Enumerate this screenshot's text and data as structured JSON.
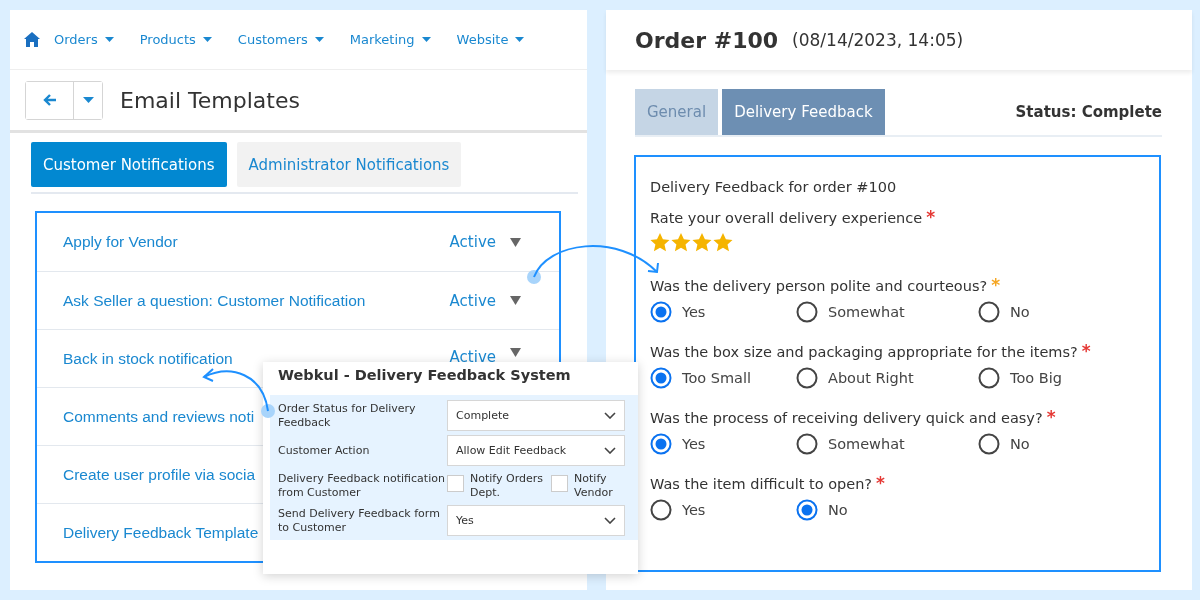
{
  "nav": {
    "items": [
      "Orders",
      "Products",
      "Customers",
      "Marketing",
      "Website"
    ]
  },
  "page": {
    "title": "Email Templates"
  },
  "template_tabs": [
    {
      "label": "Customer Notifications",
      "selected": true
    },
    {
      "label": "Administrator Notifications",
      "selected": false
    }
  ],
  "templates": [
    {
      "name": "Apply for Vendor",
      "status": "Active"
    },
    {
      "name": "Ask Seller a question: Customer Notification",
      "status": "Active"
    },
    {
      "name": "Back in stock notification",
      "status": "Active"
    },
    {
      "name": "Comments and reviews noti"
    },
    {
      "name": "Create user profile via socia"
    },
    {
      "name": "Delivery Feedback Template"
    }
  ],
  "popup": {
    "title": "Webkul - Delivery Feedback System",
    "fields": [
      {
        "kind": "select",
        "label": "Order Status for Delivery Feedback",
        "value": "Complete"
      },
      {
        "kind": "select",
        "label": "Customer Action",
        "value": "Allow Edit Feedback"
      },
      {
        "kind": "checkboxes",
        "label": "Delivery Feedback notification from Customer",
        "options": [
          {
            "label": "Notify Orders Dept.",
            "checked": false
          },
          {
            "label": "Notify Vendor",
            "checked": false
          }
        ]
      },
      {
        "kind": "select",
        "label": "Send Delivery Feedback form to Customer",
        "value": "Yes"
      }
    ]
  },
  "order": {
    "title": "Order #100",
    "date": "(08/14/2023, 14:05)",
    "tabs": [
      {
        "label": "General",
        "selected": false
      },
      {
        "label": "Delivery Feedback",
        "selected": true
      }
    ],
    "status": "Status: Complete",
    "form": {
      "heading": "Delivery Feedback for order #100",
      "rating": {
        "label": "Rate your overall delivery experience",
        "required": "*",
        "color": "#e53935",
        "stars": 4
      },
      "questions": [
        {
          "text": "Was the delivery person polite and courteous?",
          "required": "*",
          "color": "#f5a623",
          "options": [
            {
              "label": "Yes",
              "selected": true
            },
            {
              "label": "Somewhat",
              "selected": false
            },
            {
              "label": "No",
              "selected": false
            }
          ]
        },
        {
          "text": "Was the box size and packaging appropriate for the items?",
          "required": "*",
          "color": "#e53935",
          "options": [
            {
              "label": "Too Small",
              "selected": true
            },
            {
              "label": "About Right",
              "selected": false
            },
            {
              "label": "Too Big",
              "selected": false
            }
          ]
        },
        {
          "text": "Was the process of receiving delivery quick and easy?",
          "required": "*",
          "color": "#e53935",
          "options": [
            {
              "label": "Yes",
              "selected": true
            },
            {
              "label": "Somewhat",
              "selected": false
            },
            {
              "label": "No",
              "selected": false
            }
          ]
        },
        {
          "text": "Was the item difficult to open?",
          "required": "*",
          "color": "#e53935",
          "options": [
            {
              "label": "Yes",
              "selected": false
            },
            {
              "label": "No",
              "selected": true
            }
          ]
        }
      ]
    }
  }
}
